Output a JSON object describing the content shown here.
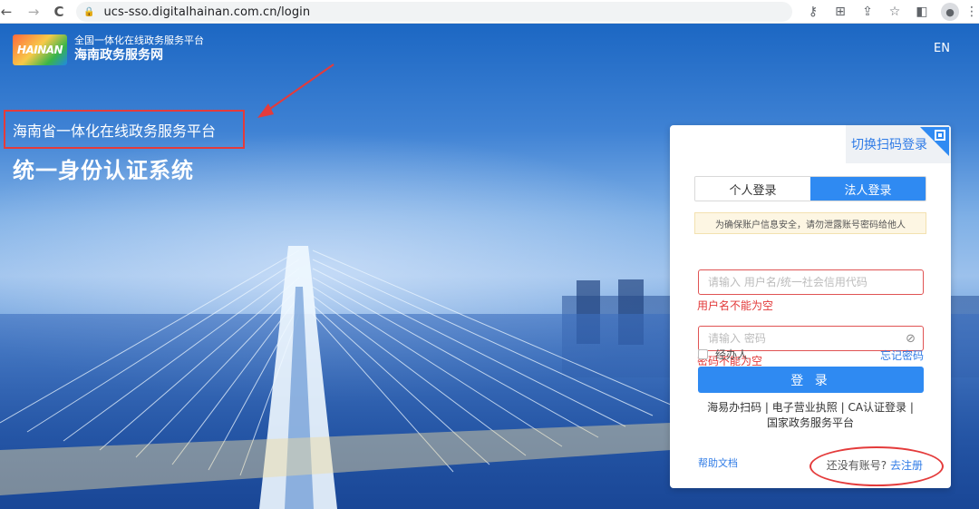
{
  "browser": {
    "back": "←",
    "forward": "→",
    "reload": "C",
    "url": "ucs-sso.digitalhainan.com.cn/login"
  },
  "header": {
    "logo_text": "HAINAN",
    "subtitle": "全国一体化在线政务服务平台",
    "title": "海南政务服务网",
    "lang": "EN"
  },
  "hero": {
    "platform": "海南省一体化在线政务服务平台",
    "system": "统一身份认证系统"
  },
  "login": {
    "qr_switch": "切换扫码登录",
    "tabs": [
      {
        "label": "个人登录",
        "active": false
      },
      {
        "label": "法人登录",
        "active": true
      }
    ],
    "notice": "为确保账户信息安全，请勿泄露账号密码给他人",
    "username_placeholder": "请输入 用户名/统一社会信用代码",
    "username_error": "用户名不能为空",
    "password_placeholder": "请输入 密码",
    "password_error": "密码不能为空",
    "agent_label": "经办人",
    "forgot": "忘记密码",
    "submit": "登 录",
    "alt_line1": "海易办扫码 | 电子营业执照 | CA认证登录 |",
    "alt_line2": "国家政务服务平台",
    "help": "帮助文档",
    "no_account": "还没有账号?",
    "register": "去注册"
  },
  "colors": {
    "accent": "#2f8af2",
    "error": "#e23838",
    "annotation": "#e43b3b"
  }
}
